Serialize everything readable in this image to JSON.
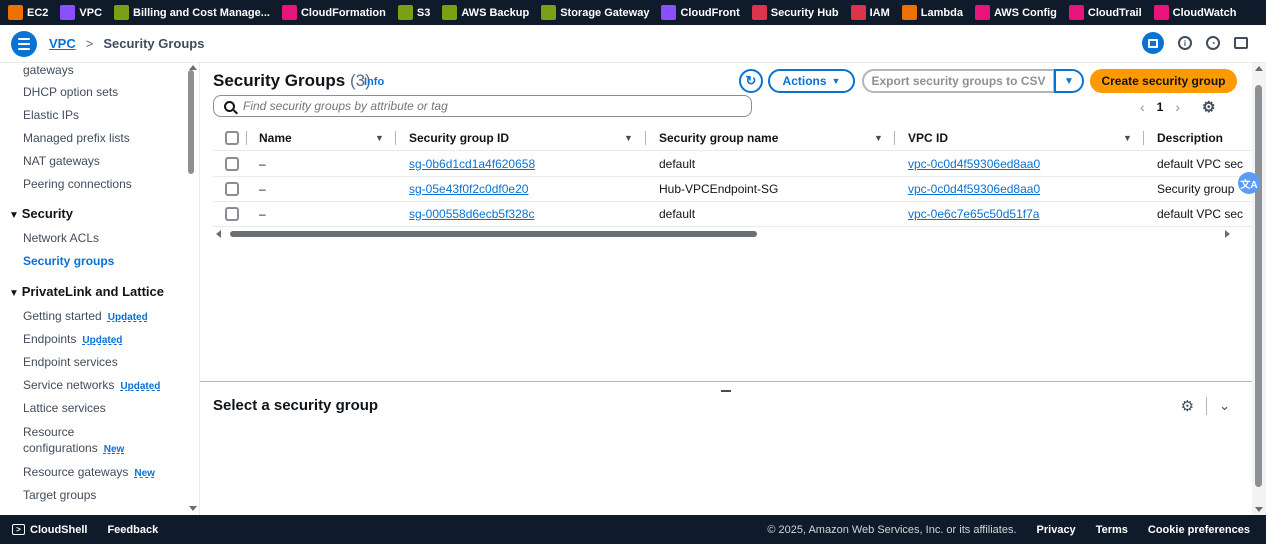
{
  "favorites": [
    {
      "label": "EC2",
      "icon": "ec2-icon",
      "color": "#ed7100"
    },
    {
      "label": "VPC",
      "icon": "vpc-icon",
      "color": "#8c4fff"
    },
    {
      "label": "Billing and Cost Manage...",
      "icon": "billing-icon",
      "color": "#7aa116"
    },
    {
      "label": "CloudFormation",
      "icon": "cloudformation-icon",
      "color": "#e7157b"
    },
    {
      "label": "S3",
      "icon": "s3-icon",
      "color": "#7aa116"
    },
    {
      "label": "AWS Backup",
      "icon": "backup-icon",
      "color": "#7aa116"
    },
    {
      "label": "Storage Gateway",
      "icon": "storage-gateway-icon",
      "color": "#7aa116"
    },
    {
      "label": "CloudFront",
      "icon": "cloudfront-icon",
      "color": "#8c4fff"
    },
    {
      "label": "Security Hub",
      "icon": "security-hub-icon",
      "color": "#dd344c"
    },
    {
      "label": "IAM",
      "icon": "iam-icon",
      "color": "#dd344c"
    },
    {
      "label": "Lambda",
      "icon": "lambda-icon",
      "color": "#ed7100"
    },
    {
      "label": "AWS Config",
      "icon": "config-icon",
      "color": "#e7157b"
    },
    {
      "label": "CloudTrail",
      "icon": "cloudtrail-icon",
      "color": "#e7157b"
    },
    {
      "label": "CloudWatch",
      "icon": "cloudwatch-icon",
      "color": "#e7157b"
    }
  ],
  "breadcrumb": {
    "root": "VPC",
    "sep": ">",
    "current": "Security Groups"
  },
  "sidebar": {
    "items": [
      {
        "label": "gateways",
        "type": "item"
      },
      {
        "label": "DHCP option sets",
        "type": "item"
      },
      {
        "label": "Elastic IPs",
        "type": "item"
      },
      {
        "label": "Managed prefix lists",
        "type": "item"
      },
      {
        "label": "NAT gateways",
        "type": "item"
      },
      {
        "label": "Peering connections",
        "type": "item"
      },
      {
        "label": "Security",
        "type": "section"
      },
      {
        "label": "Network ACLs",
        "type": "item"
      },
      {
        "label": "Security groups",
        "type": "item",
        "active": true
      },
      {
        "label": "PrivateLink and Lattice",
        "type": "section"
      },
      {
        "label": "Getting started",
        "type": "item",
        "badge": "Updated"
      },
      {
        "label": "Endpoints",
        "type": "item",
        "badge": "Updated"
      },
      {
        "label": "Endpoint services",
        "type": "item"
      },
      {
        "label": "Service networks",
        "type": "item",
        "badge": "Updated"
      },
      {
        "label": "Lattice services",
        "type": "item"
      },
      {
        "label": "Resource",
        "type": "item"
      },
      {
        "label": "configurations",
        "type": "item",
        "badge": "New"
      },
      {
        "label": "Resource gateways",
        "type": "item",
        "badge": "New"
      },
      {
        "label": "Target groups",
        "type": "item"
      }
    ]
  },
  "header": {
    "title": "Security Groups",
    "count": "(3)",
    "info": "Info",
    "refresh_icon": "refresh-icon",
    "actions": "Actions",
    "export": "Export security groups to CSV",
    "create": "Create security group",
    "search_placeholder": "Find security groups by attribute or tag",
    "page": "1"
  },
  "table": {
    "columns": [
      "Name",
      "Security group ID",
      "Security group name",
      "VPC ID",
      "Description"
    ],
    "rows": [
      {
        "name": "–",
        "id": "sg-0b6d1cd1a4f620658",
        "sgname": "default",
        "vpc": "vpc-0c0d4f59306ed8aa0",
        "desc": "default VPC sec"
      },
      {
        "name": "–",
        "id": "sg-05e43f0f2c0df0e20",
        "sgname": "Hub-VPCEndpoint-SG",
        "vpc": "vpc-0c0d4f59306ed8aa0",
        "desc": "Security group"
      },
      {
        "name": "–",
        "id": "sg-000558d6ecb5f328c",
        "sgname": "default",
        "vpc": "vpc-0e6c7e65c50d51f7a",
        "desc": "default VPC sec"
      }
    ]
  },
  "detail": {
    "title": "Select a security group"
  },
  "footer": {
    "cloudshell": "CloudShell",
    "feedback": "Feedback",
    "copyright": "© 2025, Amazon Web Services, Inc. or its affiliates.",
    "privacy": "Privacy",
    "terms": "Terms",
    "cookies": "Cookie preferences"
  }
}
